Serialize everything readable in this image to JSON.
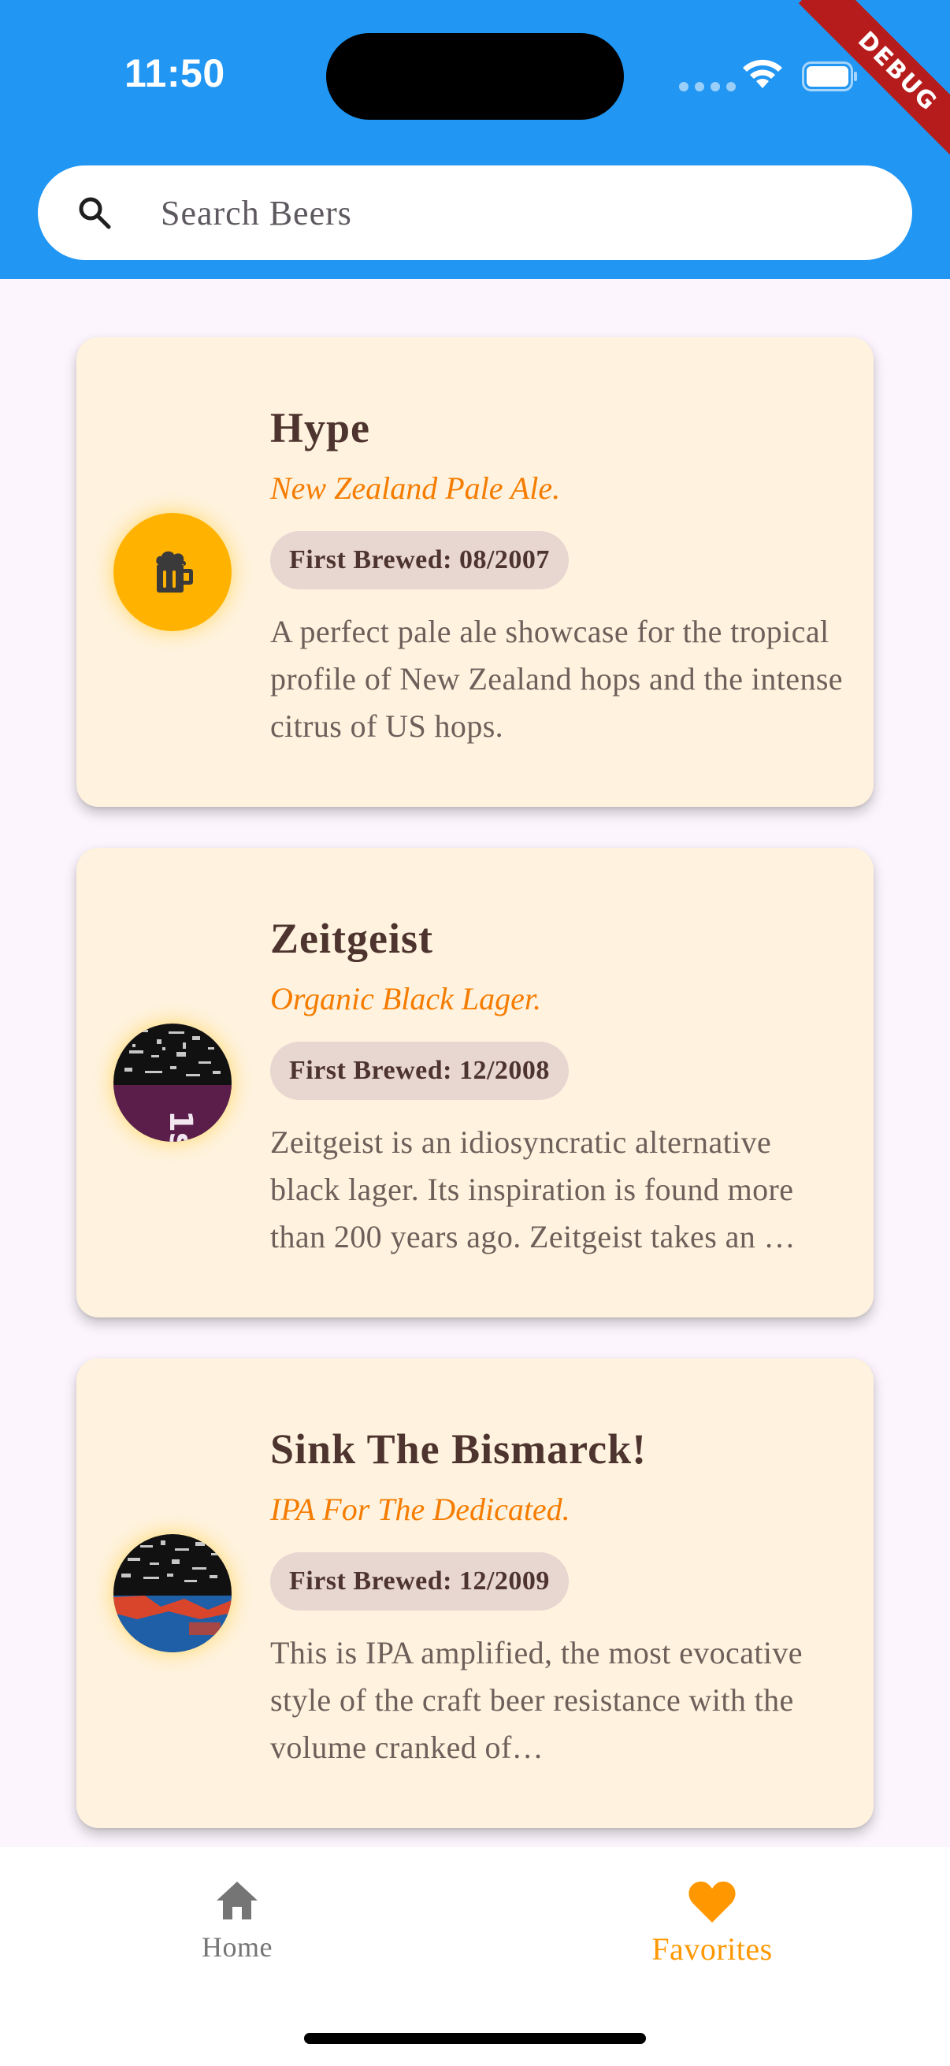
{
  "status_bar": {
    "time": "11:50",
    "debug_label": "DEBUG"
  },
  "search": {
    "placeholder": "Search Beers",
    "value": ""
  },
  "beers": [
    {
      "name": "Hype",
      "tagline": "New Zealand Pale Ale.",
      "first_brewed": "First Brewed: 08/2007",
      "description": "A perfect pale ale showcase for the tropical profile of New Zealand hops and the intense citrus of US hops.",
      "avatar": "beer-mug-icon"
    },
    {
      "name": "Zeitgeist",
      "tagline": "Organic Black Lager.",
      "first_brewed": "First Brewed: 12/2008",
      "description": "Zeitgeist is an idiosyncratic alternative black lager. Its inspiration is found more than 200 years ago. Zeitgeist takes an …",
      "avatar": "beer-label-image"
    },
    {
      "name": "Sink The Bismarck!",
      "tagline": "IPA For The Dedicated.",
      "first_brewed": "First Brewed: 12/2009",
      "description": "This is IPA amplified, the most evocative style of the craft beer resistance with the volume cranked of…",
      "avatar": "beer-label-image"
    }
  ],
  "bottom_nav": {
    "home_label": "Home",
    "favorites_label": "Favorites",
    "active": "Favorites"
  },
  "colors": {
    "app_bar": "#2196F3",
    "card_bg": "#FFF3DF",
    "title": "#4E342E",
    "tagline": "#F57C00",
    "chip_bg": "#E8D6D1",
    "active_nav": "#FF9800",
    "inactive_nav": "#757575"
  }
}
